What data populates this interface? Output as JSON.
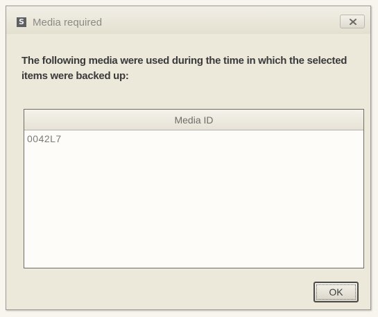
{
  "window": {
    "title": "Media required",
    "icon": "app-icon"
  },
  "message": "The following media were used during the time in which the selected items were backed up:",
  "table": {
    "column_header": "Media ID",
    "rows": [
      "0042L7"
    ]
  },
  "buttons": {
    "ok_label": "OK",
    "close_icon": "close-icon"
  }
}
